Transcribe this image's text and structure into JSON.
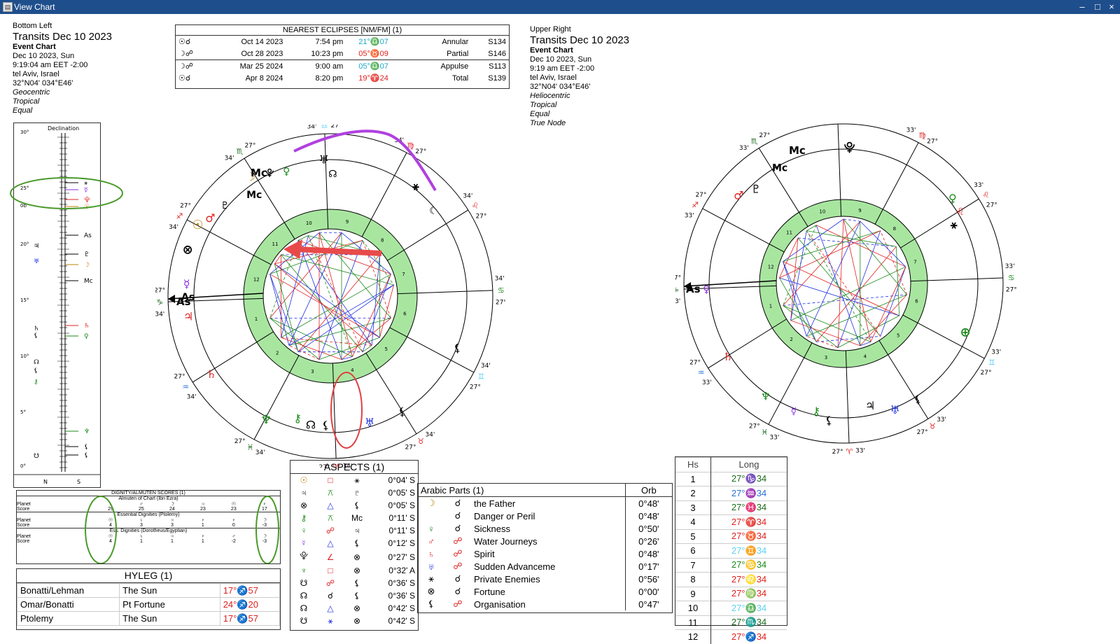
{
  "window": {
    "title": "View Chart",
    "minimize": "–",
    "maximize": "□",
    "close": "×"
  },
  "left_info": {
    "caption": "Bottom Left",
    "title": "Transits Dec 10 2023",
    "chart_type": "Event Chart",
    "date": "Dec 10 2023, Sun",
    "time": "9:19:04 am  EET -2:00",
    "place": "tel Aviv, Israel",
    "coords": "32°N04' 034°E46'",
    "opt1": "Geocentric",
    "opt2": "Tropical",
    "opt3": "Equal"
  },
  "right_info": {
    "caption": "Upper Right",
    "title": "Transits Dec 10 2023",
    "chart_type": "Event Chart",
    "date": "Dec 10 2023, Sun",
    "time": "9:19 am  EET -2:00",
    "place": "tel Aviv, Israel",
    "coords": "32°N04' 034°E46'",
    "opt1": "Heliocentric",
    "opt2": "Tropical",
    "opt3": "Equal",
    "opt4": "True Node"
  },
  "eclipses": {
    "header": "NEAREST ECLIPSES [NM/FM] (1)",
    "rows": [
      {
        "sym": "☉☌",
        "date": "Oct 14 2023",
        "time": "7:54 pm",
        "pos": "21°♎07",
        "color": "#1aa9c8",
        "kind": "Annular",
        "saros": "S134"
      },
      {
        "sym": "☽☍",
        "date": "Oct 28 2023",
        "time": "10:23 pm",
        "pos": "05°♉09",
        "color": "#e02020",
        "kind": "Partial",
        "saros": "S146"
      },
      {
        "sym": "☽☍",
        "date": "Mar 25 2024",
        "time": "9:00 am",
        "pos": "05°♎07",
        "color": "#1aa9c8",
        "kind": "Appulse",
        "saros": "S113"
      },
      {
        "sym": "☉☌",
        "date": "Apr 8 2024",
        "time": "8:20 pm",
        "pos": "19°♈24",
        "color": "#e02020",
        "kind": "Total",
        "saros": "S139"
      }
    ]
  },
  "declination": {
    "title": "Declination",
    "scale": [
      "30°",
      "25°",
      "0b",
      "20°",
      "15°",
      "10°",
      "5°",
      "0°"
    ],
    "foot_n": "N",
    "foot_s": "S"
  },
  "dignity": {
    "title": "DIGNITY/ALMUTEN SCORES (1)",
    "sec1": "Almuten of Chart (Ibn Ezra)",
    "sec2": "Essential Dignities (Ptolemy)",
    "sec3": "Ess. Dignities (Dorotheus/Egyptian)",
    "planet_label": "Planet",
    "score_label": "Score",
    "row1_planets": [
      "♄",
      "♂",
      "☽",
      "♃",
      "☉",
      "♀"
    ],
    "row1_scores": [
      "29",
      "25",
      "24",
      "23",
      "23",
      "17"
    ],
    "row2_planets": [
      "☉",
      "♄",
      "♃",
      "♀",
      "♀",
      "☽"
    ],
    "row2_scores": [
      "4",
      "3",
      "3",
      "1",
      "0",
      "-3"
    ],
    "row3_planets": [
      "☉",
      "♄",
      "♃",
      "♀",
      "♂",
      "☽"
    ],
    "row3_scores": [
      "4",
      "1",
      "1",
      "1",
      "-2",
      "-3"
    ]
  },
  "hyleg": {
    "title": "HYLEG (1)",
    "rows": [
      {
        "method": "Bonatti/Lehman",
        "point": "The Sun",
        "pos": "17°♐57"
      },
      {
        "method": "Omar/Bonatti",
        "point": "Pt Fortune",
        "pos": "24°♐20"
      },
      {
        "method": "Ptolemy",
        "point": "The Sun",
        "pos": "17°♐57"
      }
    ]
  },
  "aspects": {
    "title": "ASPECTS (1)",
    "rows": [
      {
        "a": "☉",
        "asp": "□",
        "b": "⚹",
        "orb": "0°04' S",
        "ca": "#b8860b",
        "cs": "#e02020"
      },
      {
        "a": "♃",
        "asp": "⚻",
        "b": "♇",
        "orb": "0°05' S",
        "ca": "#000",
        "cs": "#1b8a1b"
      },
      {
        "a": "⊗",
        "asp": "△",
        "b": "⚸",
        "orb": "0°05' S",
        "ca": "#000",
        "cs": "#2030e0"
      },
      {
        "a": "⚷",
        "asp": "⚻",
        "b": "Mc",
        "orb": "0°11' S",
        "ca": "#1b8a1b",
        "cs": "#1b8a1b"
      },
      {
        "a": "♀",
        "asp": "☍",
        "b": "♃",
        "orb": "0°11' S",
        "ca": "#1b8a1b",
        "cs": "#e02020"
      },
      {
        "a": "☿",
        "asp": "△",
        "b": "⚸",
        "orb": "0°12' S",
        "ca": "#8a2be2",
        "cs": "#2030e0"
      },
      {
        "a": "⯓",
        "asp": "∠",
        "b": "⊗",
        "orb": "0°27' S",
        "ca": "#000",
        "cs": "#e02020"
      },
      {
        "a": "♆",
        "asp": "□",
        "b": "⊗",
        "orb": "0°32' A",
        "ca": "#1b8a1b",
        "cs": "#e02020"
      },
      {
        "a": "☋",
        "asp": "☍",
        "b": "⚸",
        "orb": "0°36' S",
        "ca": "#000",
        "cs": "#e02020"
      },
      {
        "a": "☊",
        "asp": "☌",
        "b": "⚸",
        "orb": "0°36' S",
        "ca": "#000",
        "cs": "#000"
      },
      {
        "a": "☊",
        "asp": "△",
        "b": "⊗",
        "orb": "0°42' S",
        "ca": "#000",
        "cs": "#2030e0"
      },
      {
        "a": "☋",
        "asp": "⚹",
        "b": "⊗",
        "orb": "0°42' S",
        "ca": "#000",
        "cs": "#2030e0"
      }
    ]
  },
  "arabic": {
    "title": "Arabic Parts (1)",
    "orb_header": "Orb",
    "rows": [
      {
        "sym": "☽",
        "asp": "☌",
        "name": "the Father",
        "orb": "0°48'",
        "cs": "#b8860b",
        "ca": "#000"
      },
      {
        "sym": "",
        "asp": "☌",
        "name": "Danger or Peril",
        "orb": "0°48'",
        "cs": "#000",
        "ca": "#000"
      },
      {
        "sym": "♀",
        "asp": "☌",
        "name": "Sickness",
        "orb": "0°50'",
        "cs": "#1b8a1b",
        "ca": "#000"
      },
      {
        "sym": "♂",
        "asp": "☍",
        "name": "Water Journeys",
        "orb": "0°26'",
        "cs": "#e02020",
        "ca": "#e02020"
      },
      {
        "sym": "♄",
        "asp": "☍",
        "name": "Spirit",
        "orb": "0°48'",
        "cs": "#e02020",
        "ca": "#e02020"
      },
      {
        "sym": "♅",
        "asp": "☍",
        "name": "Sudden Advanceme",
        "orb": "0°17'",
        "cs": "#2030e0",
        "ca": "#e02020"
      },
      {
        "sym": "⚹",
        "asp": "☌",
        "name": "Private Enemies",
        "orb": "0°56'",
        "cs": "#000",
        "ca": "#000"
      },
      {
        "sym": "⊗",
        "asp": "☌",
        "name": "Fortune",
        "orb": "0°00'",
        "cs": "#000",
        "ca": "#000"
      },
      {
        "sym": "⚸",
        "asp": "☍",
        "name": "Organisation",
        "orb": "0°47'",
        "cs": "#000",
        "ca": "#e02020"
      }
    ]
  },
  "houses": {
    "col1": "Hs",
    "col2": "Long",
    "rows": [
      {
        "n": "1",
        "pos": "27°♑34",
        "color": "#1b6a1b"
      },
      {
        "n": "2",
        "pos": "27°♒34",
        "color": "#2a6fdb"
      },
      {
        "n": "3",
        "pos": "27°♓34",
        "color": "#1b6a1b"
      },
      {
        "n": "4",
        "pos": "27°♈34",
        "color": "#e02020"
      },
      {
        "n": "5",
        "pos": "27°♉34",
        "color": "#e02020"
      },
      {
        "n": "6",
        "pos": "27°♊34",
        "color": "#5fd0f0"
      },
      {
        "n": "7",
        "pos": "27°♋34",
        "color": "#1b8a1b"
      },
      {
        "n": "8",
        "pos": "27°♌34",
        "color": "#e02020"
      },
      {
        "n": "9",
        "pos": "27°♍34",
        "color": "#e02020"
      },
      {
        "n": "10",
        "pos": "27°♎34",
        "color": "#5fd0f0"
      },
      {
        "n": "11",
        "pos": "27°♏34",
        "color": "#1b6a1b"
      },
      {
        "n": "12",
        "pos": "27°♐34",
        "color": "#e02020"
      }
    ]
  },
  "wheel_left": {
    "asc_label": "As",
    "mc_label": "Mc",
    "cusp_degree": "27°",
    "cusp_minute": "34'",
    "signs": [
      "♑",
      "♒",
      "♓",
      "♈",
      "♉",
      "♊",
      "♋",
      "♌",
      "♍",
      "♎",
      "♏",
      "♐"
    ],
    "sign_colors": [
      "#1b6a1b",
      "#2a6fdb",
      "#1b6a1b",
      "#e02020",
      "#e02020",
      "#5fd0f0",
      "#1b8a1b",
      "#e02020",
      "#e02020",
      "#5fd0f0",
      "#1b6a1b",
      "#e02020"
    ]
  },
  "wheel_right": {
    "asc_label": "As",
    "mc_label": "Mc",
    "cusp_degree": "27°",
    "cusp_minute": "33'"
  }
}
